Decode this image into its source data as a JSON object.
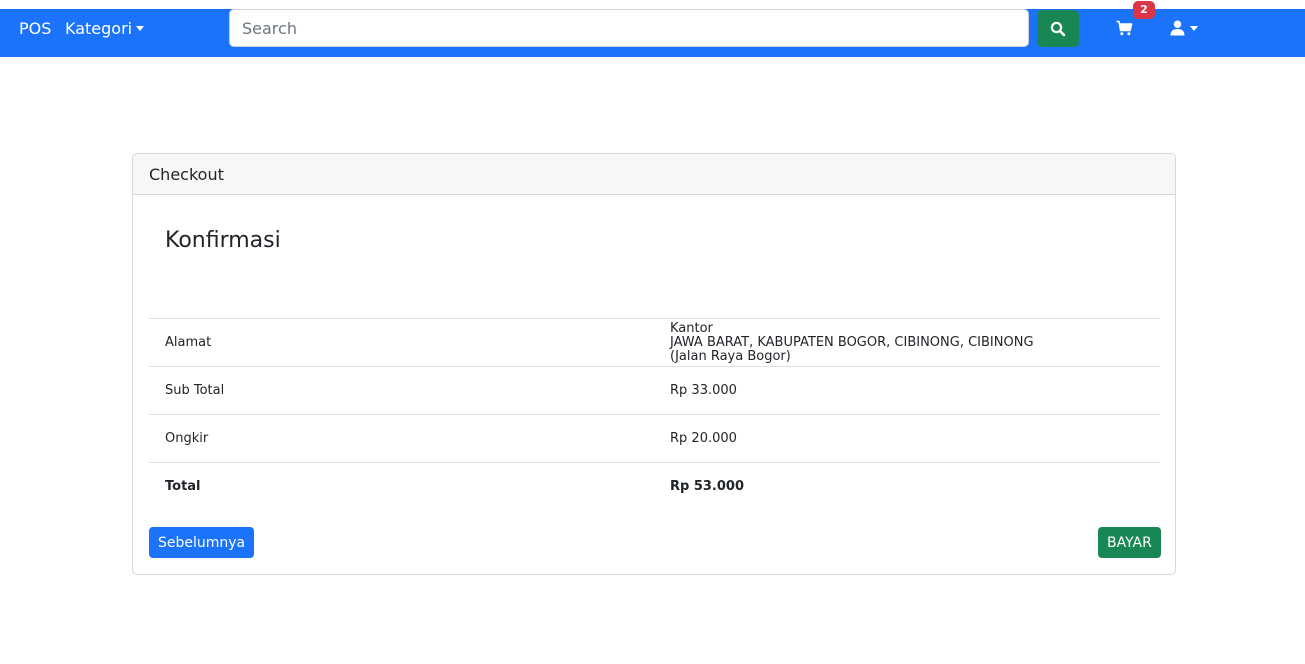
{
  "navbar": {
    "brand": "POS",
    "category_label": "Kategori",
    "search_placeholder": "Search",
    "cart_count": "2",
    "colors": {
      "navbar": "#1a73f8",
      "search_button": "#198754",
      "badge": "#dc3545"
    }
  },
  "card": {
    "header": "Checkout",
    "title": "Konfirmasi"
  },
  "summary": {
    "address_label": "Alamat",
    "address_lines": [
      "Kantor",
      "JAWA BARAT, KABUPATEN BOGOR, CIBINONG, CIBINONG",
      "(Jalan Raya Bogor)"
    ],
    "subtotal_label": "Sub Total",
    "subtotal_value": "Rp 33.000",
    "shipping_label": "Ongkir",
    "shipping_value": "Rp 20.000",
    "total_label": "Total",
    "total_value": "Rp 53.000"
  },
  "actions": {
    "previous": "Sebelumnya",
    "pay": "BAYAR"
  }
}
